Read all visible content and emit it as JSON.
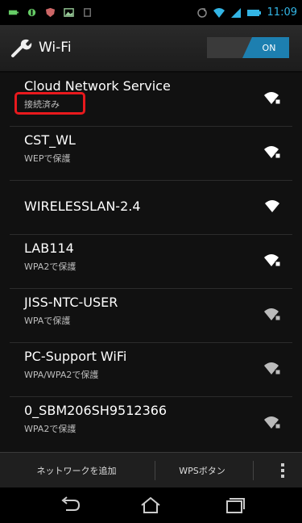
{
  "status_bar": {
    "time": "11:09",
    "left_icons": [
      "battery-icon",
      "notification-icon",
      "shield-icon",
      "image-icon",
      "storage-icon"
    ],
    "right_icons": [
      "rotation-icon",
      "wifi-signal-icon",
      "cell-signal-icon",
      "battery-icon"
    ]
  },
  "action_bar": {
    "title": "Wi-Fi",
    "toggle_label": "ON",
    "toggle_color": "#1d7fb0"
  },
  "networks": [
    {
      "name": "Cloud Network Service",
      "status": "接続済み"
    },
    {
      "name": "CST_WL",
      "status": "WEPで保護"
    },
    {
      "name": "WIRELESSLAN-2.4",
      "status": ""
    },
    {
      "name": "LAB114",
      "status": "WPA2で保護"
    },
    {
      "name": "JISS-NTC-USER",
      "status": "WPAで保護"
    },
    {
      "name": "PC-Support WiFi",
      "status": "WPA/WPA2で保護"
    },
    {
      "name": "0_SBM206SH9512366",
      "status": "WPA2で保護"
    }
  ],
  "bottom_bar": {
    "add_network": "ネットワークを追加",
    "wps_button": "WPSボタン"
  },
  "highlight_color": "#e8191d"
}
